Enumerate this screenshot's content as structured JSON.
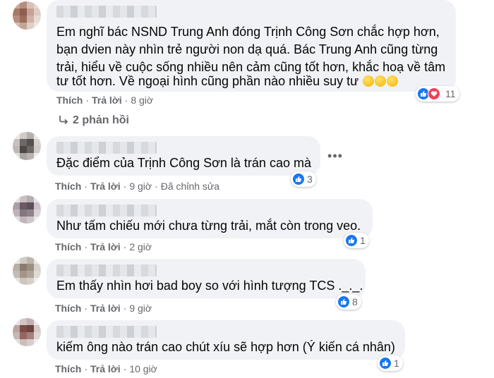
{
  "colors": {
    "bubble": "#f0f2f5",
    "meta": "#65676b",
    "like": "#1877f2",
    "love": "#f33e58"
  },
  "actions": {
    "like": "Thích",
    "reply": "Trả lời",
    "separator": "·"
  },
  "comments": [
    {
      "lines": [
        "Em nghĩ bác NSND Trung Anh đóng Trịnh Công Sơn chắc hợp hơn,",
        "bạn dvien này nhìn trẻ người non dạ quá. Bác Trung Anh cũng từng",
        "trải, hiểu về cuộc sống nhiều nên cảm cũng tốt hơn, khắc hoạ về tâm",
        "tư tốt hơn. Về ngoại hình cũng phần nào nhiều suy tư"
      ],
      "emoji": [
        "thinking-face",
        "thinking-face",
        "thinking-face"
      ],
      "time": "8 giờ",
      "reaction_count": "11",
      "reactions": [
        "like",
        "love"
      ]
    },
    {
      "text": "Đặc điểm của Trịnh Công Sơn là trán cao mà",
      "time": "9 giờ",
      "edited": "Đã chỉnh sửa",
      "reaction_count": "3"
    },
    {
      "text": "Như tấm chiếu mới chưa từng trải, mắt còn trong veo.",
      "time": "2 giờ",
      "reaction_count": "1"
    },
    {
      "text": "Em thấy nhìn hơi bad boy so với hình tượng TCS ._._.",
      "time": "9 giờ",
      "reaction_count": "8"
    },
    {
      "text": "kiếm ông nào trán cao chút xíu sẽ hợp hơn (Ý kiến cá nhân)",
      "time": "10 giờ",
      "reaction_count": "1"
    }
  ],
  "replies_label": "2 phản hồi",
  "icons": {
    "reply_arrow": "reply-arrow-icon",
    "more": "more-options-icon"
  }
}
